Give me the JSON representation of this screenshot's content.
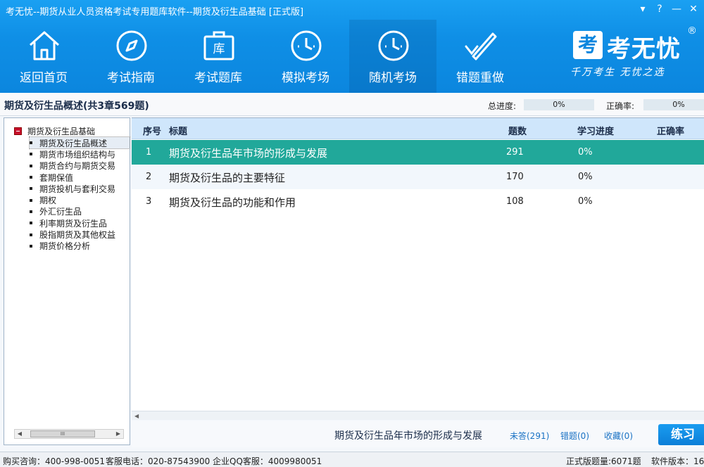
{
  "window": {
    "title": "考无忧--期货从业人员资格考试专用题库软件--期货及衍生品基础 [正式版]",
    "buttons": [
      "▾",
      "?",
      "—",
      "✕"
    ]
  },
  "toolbar": [
    {
      "label": "返回首页",
      "icon": "home-icon"
    },
    {
      "label": "考试指南",
      "icon": "compass-icon"
    },
    {
      "label": "考试题库",
      "icon": "question-bank-icon"
    },
    {
      "label": "模拟考场",
      "icon": "clock-icon"
    },
    {
      "label": "随机考场",
      "icon": "clock-icon",
      "active": true
    },
    {
      "label": "错题重做",
      "icon": "check-pencil-icon"
    }
  ],
  "logo": {
    "mark": "考",
    "name": "考无忧",
    "reg": "®",
    "slogan": "千万考生  无忧之选"
  },
  "header": {
    "title": "期货及衍生品概述(共3章569题)",
    "total_progress_label": "总进度:",
    "total_progress_value": "0%",
    "accuracy_label": "正确率:",
    "accuracy_value": "0%"
  },
  "tree": {
    "root": "期货及衍生品基础",
    "items": [
      "期货及衍生品概述",
      "期货市场组织结构与",
      "期货合约与期货交易",
      "套期保值",
      "期货投机与套利交易",
      "期权",
      "外汇衍生品",
      "利率期货及衍生品",
      "股指期货及其他权益",
      "期货价格分析"
    ],
    "selected_index": 0,
    "scroll_thumb": "III"
  },
  "table": {
    "columns": [
      "序号",
      "标题",
      "题数",
      "学习进度",
      "正确率"
    ],
    "rows": [
      {
        "no": "1",
        "title": "期货及衍生品年市场的形成与发展",
        "count": "291",
        "progress": "0%",
        "accuracy": ""
      },
      {
        "no": "2",
        "title": "期货及衍生品的主要特征",
        "count": "170",
        "progress": "0%",
        "accuracy": ""
      },
      {
        "no": "3",
        "title": "期货及衍生品的功能和作用",
        "count": "108",
        "progress": "0%",
        "accuracy": ""
      }
    ]
  },
  "action": {
    "selected_title": "期货及衍生品年市场的形成与发展",
    "unanswered": "未答(291)",
    "wrong": "错题(0)",
    "favorites": "收藏(0)",
    "practice": "练习"
  },
  "status": {
    "buy": "购买咨询：400-998-0051",
    "service": "客服电话：020-87543900",
    "qq": "企业QQ客服：4009980051",
    "count": "正式版题量:6071题",
    "version": "软件版本：16"
  },
  "colors": {
    "brand": "#0b86de",
    "active_row": "#21a89a",
    "header_row": "#cfe6fb"
  }
}
